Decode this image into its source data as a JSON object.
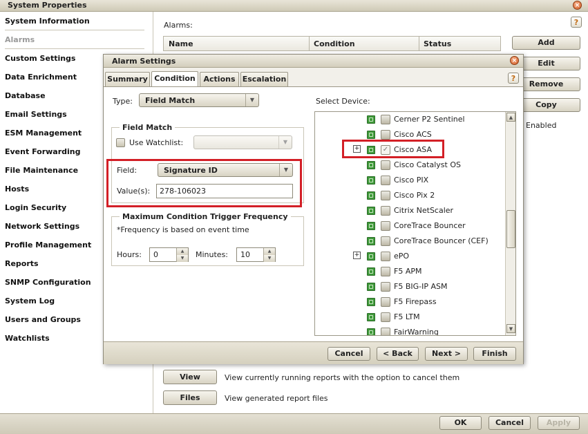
{
  "window": {
    "title": "System Properties"
  },
  "sidebar": {
    "items": [
      {
        "label": "System Information",
        "disabled": false
      },
      {
        "label": "Alarms",
        "disabled": true
      },
      {
        "label": "Custom Settings",
        "disabled": false
      },
      {
        "label": "Data Enrichment",
        "disabled": false
      },
      {
        "label": "Database",
        "disabled": false
      },
      {
        "label": "Email Settings",
        "disabled": false
      },
      {
        "label": "ESM Management",
        "disabled": false
      },
      {
        "label": "Event Forwarding",
        "disabled": false
      },
      {
        "label": "File Maintenance",
        "disabled": false
      },
      {
        "label": "Hosts",
        "disabled": false
      },
      {
        "label": "Login Security",
        "disabled": false
      },
      {
        "label": "Network Settings",
        "disabled": false
      },
      {
        "label": "Profile Management",
        "disabled": false
      },
      {
        "label": "Reports",
        "disabled": false
      },
      {
        "label": "SNMP Configuration",
        "disabled": false
      },
      {
        "label": "System Log",
        "disabled": false
      },
      {
        "label": "Users and Groups",
        "disabled": false
      },
      {
        "label": "Watchlists",
        "disabled": false
      }
    ]
  },
  "alarms": {
    "label": "Alarms:",
    "columns": [
      "Name",
      "Condition",
      "Status"
    ],
    "status_value": "Enabled",
    "buttons": {
      "add": "Add",
      "edit": "Edit",
      "remove": "Remove",
      "copy": "Copy"
    }
  },
  "reports": {
    "view_label": "View",
    "view_desc": "View currently running reports with the option to cancel them",
    "files_label": "Files",
    "files_desc": "View generated report files"
  },
  "footer": {
    "ok": "OK",
    "cancel": "Cancel",
    "apply": "Apply"
  },
  "dialog": {
    "title": "Alarm Settings",
    "tabs": [
      "Summary",
      "Condition",
      "Actions",
      "Escalation"
    ],
    "active_tab": "Condition",
    "type_label": "Type:",
    "type_value": "Field Match",
    "field_match": {
      "title": "Field Match",
      "use_watchlist_label": "Use Watchlist:",
      "field_label": "Field:",
      "field_value": "Signature ID",
      "values_label": "Value(s):",
      "values_value": "278-106023"
    },
    "frequency": {
      "title": "Maximum Condition Trigger Frequency",
      "note": "*Frequency is based on event time",
      "hours_label": "Hours:",
      "hours_value": "0",
      "minutes_label": "Minutes:",
      "minutes_value": "10"
    },
    "select_device_label": "Select Device:",
    "devices": [
      {
        "name": "Cerner P2 Sentinel",
        "expandable": false,
        "checked": false
      },
      {
        "name": "Cisco ACS",
        "expandable": false,
        "checked": false
      },
      {
        "name": "Cisco ASA",
        "expandable": true,
        "checked": true
      },
      {
        "name": "Cisco Catalyst OS",
        "expandable": false,
        "checked": false
      },
      {
        "name": "Cisco PIX",
        "expandable": false,
        "checked": false
      },
      {
        "name": "Cisco Pix 2",
        "expandable": false,
        "checked": false
      },
      {
        "name": "Citrix NetScaler",
        "expandable": false,
        "checked": false
      },
      {
        "name": "CoreTrace Bouncer",
        "expandable": false,
        "checked": false
      },
      {
        "name": "CoreTrace Bouncer (CEF)",
        "expandable": false,
        "checked": false
      },
      {
        "name": "ePO",
        "expandable": true,
        "checked": false
      },
      {
        "name": "F5 APM",
        "expandable": false,
        "checked": false
      },
      {
        "name": "F5 BIG-IP ASM",
        "expandable": false,
        "checked": false
      },
      {
        "name": "F5 Firepass",
        "expandable": false,
        "checked": false
      },
      {
        "name": "F5 LTM",
        "expandable": false,
        "checked": false
      },
      {
        "name": "FairWarning",
        "expandable": false,
        "checked": false
      }
    ],
    "buttons": {
      "cancel": "Cancel",
      "back": "< Back",
      "next": "Next >",
      "finish": "Finish"
    }
  },
  "icons": {
    "close": "close-icon",
    "help": "help-icon",
    "dropdown": "chevron-down-icon"
  }
}
